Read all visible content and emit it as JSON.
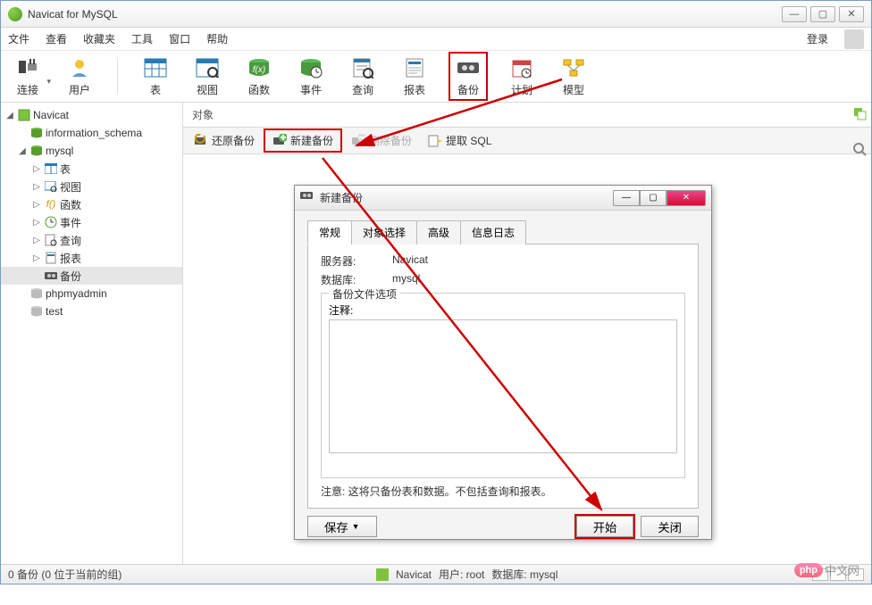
{
  "window": {
    "title": "Navicat for MySQL",
    "controls": {
      "min": "—",
      "max": "▢",
      "close": "✕"
    }
  },
  "menubar": {
    "items": [
      "文件",
      "查看",
      "收藏夹",
      "工具",
      "窗口",
      "帮助"
    ],
    "login": "登录"
  },
  "toolbar": {
    "items": [
      {
        "label": "连接",
        "icon": "plug-icon"
      },
      {
        "label": "用户",
        "icon": "user-icon"
      },
      {
        "label": "表",
        "icon": "table-icon"
      },
      {
        "label": "视图",
        "icon": "view-icon"
      },
      {
        "label": "函数",
        "icon": "function-icon"
      },
      {
        "label": "事件",
        "icon": "event-icon"
      },
      {
        "label": "查询",
        "icon": "query-icon"
      },
      {
        "label": "报表",
        "icon": "report-icon"
      },
      {
        "label": "备份",
        "icon": "backup-icon"
      },
      {
        "label": "计划",
        "icon": "schedule-icon"
      },
      {
        "label": "模型",
        "icon": "model-icon"
      }
    ]
  },
  "sidebar": {
    "items": [
      {
        "label": "Navicat",
        "level": 0,
        "expanded": true,
        "icon": "connection-icon"
      },
      {
        "label": "information_schema",
        "level": 1,
        "icon": "database-icon"
      },
      {
        "label": "mysql",
        "level": 1,
        "expanded": true,
        "icon": "database-icon"
      },
      {
        "label": "表",
        "level": 2,
        "icon": "table-small-icon"
      },
      {
        "label": "视图",
        "level": 2,
        "icon": "view-small-icon"
      },
      {
        "label": "函数",
        "level": 2,
        "icon": "function-small-icon"
      },
      {
        "label": "事件",
        "level": 2,
        "icon": "event-small-icon"
      },
      {
        "label": "查询",
        "level": 2,
        "icon": "query-small-icon"
      },
      {
        "label": "报表",
        "level": 2,
        "icon": "report-small-icon"
      },
      {
        "label": "备份",
        "level": 2,
        "icon": "backup-small-icon",
        "selected": true
      },
      {
        "label": "phpmyadmin",
        "level": 1,
        "icon": "database-off-icon"
      },
      {
        "label": "test",
        "level": 1,
        "icon": "database-off-icon"
      }
    ]
  },
  "content": {
    "header": "对象",
    "actions": [
      {
        "label": "还原备份",
        "icon": "restore-icon"
      },
      {
        "label": "新建备份",
        "icon": "new-icon",
        "highlight": true
      },
      {
        "label": "删除备份",
        "icon": "delete-icon",
        "disabled": true
      },
      {
        "label": "提取 SQL",
        "icon": "extract-icon"
      }
    ]
  },
  "dialog": {
    "title": "新建备份",
    "tabs": [
      "常规",
      "对象选择",
      "高级",
      "信息日志"
    ],
    "active_tab": 0,
    "server_label": "服务器:",
    "server_value": "Navicat",
    "db_label": "数据库:",
    "db_value": "mysql",
    "fieldset_legend": "备份文件选项",
    "note_label": "注释:",
    "note_value": "",
    "hint": "注意: 这将只备份表和数据。不包括查询和报表。",
    "buttons": {
      "save": "保存",
      "start": "开始",
      "close": "关闭"
    }
  },
  "statusbar": {
    "left": "0 备份 (0 位于当前的组)",
    "conn": "Navicat",
    "user": "用户: root",
    "db": "数据库: mysql"
  },
  "watermark": {
    "badge": "php",
    "text": "中文网"
  }
}
